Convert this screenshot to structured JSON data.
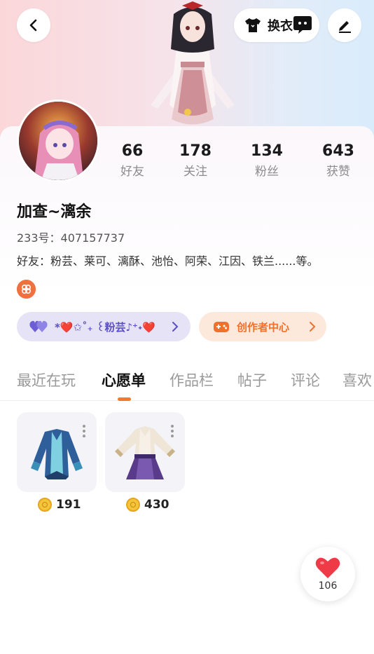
{
  "header": {
    "outfit_label": "换衣",
    "colors": {
      "hero_left": "#fbd7d9",
      "hero_right": "#d9ecfb"
    }
  },
  "profile": {
    "stats": [
      {
        "value": "66",
        "label": "好友"
      },
      {
        "value": "178",
        "label": "关注"
      },
      {
        "value": "134",
        "label": "粉丝"
      },
      {
        "value": "643",
        "label": "获赞"
      }
    ],
    "username": "加查~漓余",
    "id_line": "233号：407157737",
    "friends_line": "好友：粉芸、莱可、漓酥、池怡、阿荣、江因、铁兰......等。",
    "badge_text": "*❤️✩˚₊ ꒰粉芸♪⁺˖❤️",
    "creator_center": "创作者中心",
    "colors": {
      "accent": "#f27a2c",
      "badge_text": "#5b4fc4"
    }
  },
  "tabs": [
    "最近在玩",
    "心愿单",
    "作品栏",
    "帖子",
    "评论",
    "喜欢"
  ],
  "active_tab": "心愿单",
  "wishlist": [
    {
      "icon": "blue-robe-outfit",
      "price": "191"
    },
    {
      "icon": "purple-dress-outfit",
      "price": "430"
    }
  ],
  "like_button": {
    "count": "106"
  }
}
